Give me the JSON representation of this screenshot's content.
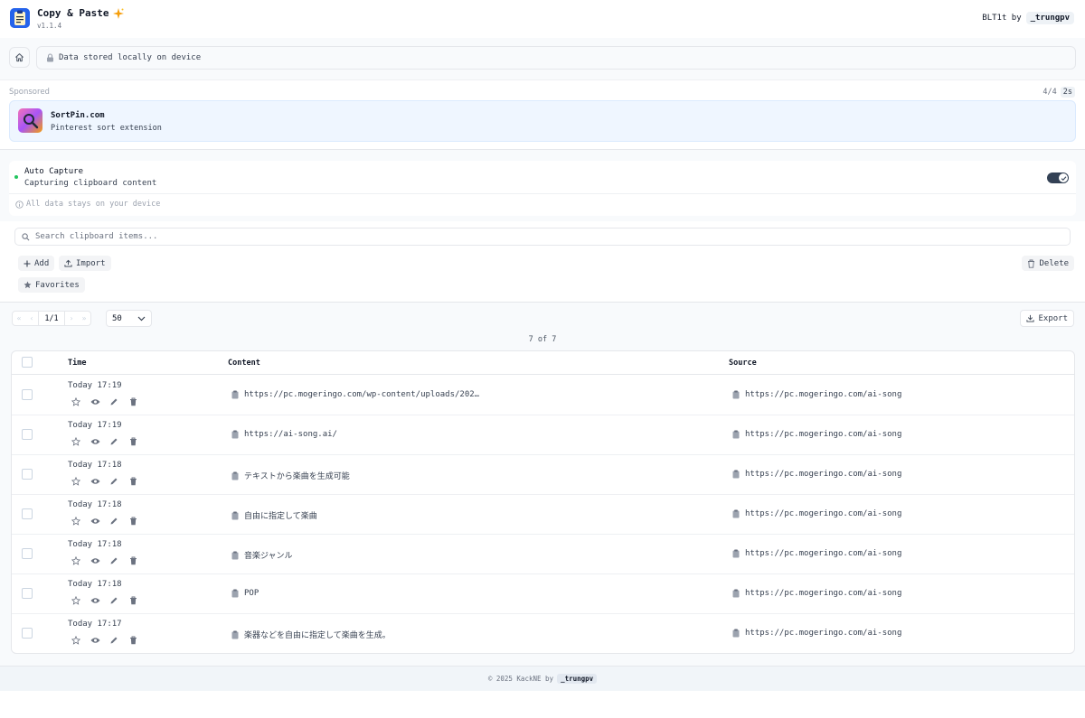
{
  "app": {
    "title": "Copy & Paste",
    "version": "v1.1.4",
    "credit_prefix": "BLT1t by",
    "credit_author": "_trungpv"
  },
  "nav": {
    "storage_notice": "Data stored locally on device"
  },
  "sponsored": {
    "label": "Sponsored",
    "count": "4/4",
    "timer": "2s",
    "name": "SortPin.com",
    "description": "Pinterest sort extension"
  },
  "auto_capture": {
    "title": "Auto Capture",
    "status": "Capturing clipboard content",
    "enabled": true,
    "privacy_note": "All data stays on your device"
  },
  "search": {
    "placeholder": "Search clipboard items...",
    "value": ""
  },
  "actions": {
    "add": "Add",
    "import": "Import",
    "delete": "Delete",
    "favorites": "Favorites",
    "export": "Export"
  },
  "pagination": {
    "page": "1/1",
    "page_size": "50",
    "result_count": "7 of 7"
  },
  "table": {
    "columns": {
      "time": "Time",
      "content": "Content",
      "source": "Source"
    },
    "rows": [
      {
        "time": "Today 17:19",
        "content": "https://pc.mogeringo.com/wp-content/uploads/202…",
        "source": "https://pc.mogeringo.com/ai-song"
      },
      {
        "time": "Today 17:19",
        "content": "https://ai-song.ai/",
        "source": "https://pc.mogeringo.com/ai-song"
      },
      {
        "time": "Today 17:18",
        "content": "テキストから楽曲を生成可能",
        "source": "https://pc.mogeringo.com/ai-song"
      },
      {
        "time": "Today 17:18",
        "content": "自由に指定して楽曲",
        "source": "https://pc.mogeringo.com/ai-song"
      },
      {
        "time": "Today 17:18",
        "content": "音楽ジャンル",
        "source": "https://pc.mogeringo.com/ai-song"
      },
      {
        "time": "Today 17:18",
        "content": "POP",
        "source": "https://pc.mogeringo.com/ai-song"
      },
      {
        "time": "Today 17:17",
        "content": "楽器などを自由に指定して楽曲を生成。",
        "source": "https://pc.mogeringo.com/ai-song"
      }
    ]
  },
  "footer": {
    "text": "© 2025 KackNE by",
    "author": "_trungpv"
  },
  "icons": [
    "clipboard-logo-icon",
    "sparkle-icon",
    "home-icon",
    "lock-icon",
    "search-icon",
    "plus-icon",
    "upload-icon",
    "trash-icon",
    "star-icon",
    "download-icon",
    "eye-icon",
    "pencil-icon",
    "info-icon",
    "check-icon",
    "chevron-down-icon"
  ],
  "colors": {
    "accent": "#2563eb",
    "live_dot": "#22c55e",
    "toggle_on": "#334155",
    "sponsor_bg": "#eff6ff"
  }
}
